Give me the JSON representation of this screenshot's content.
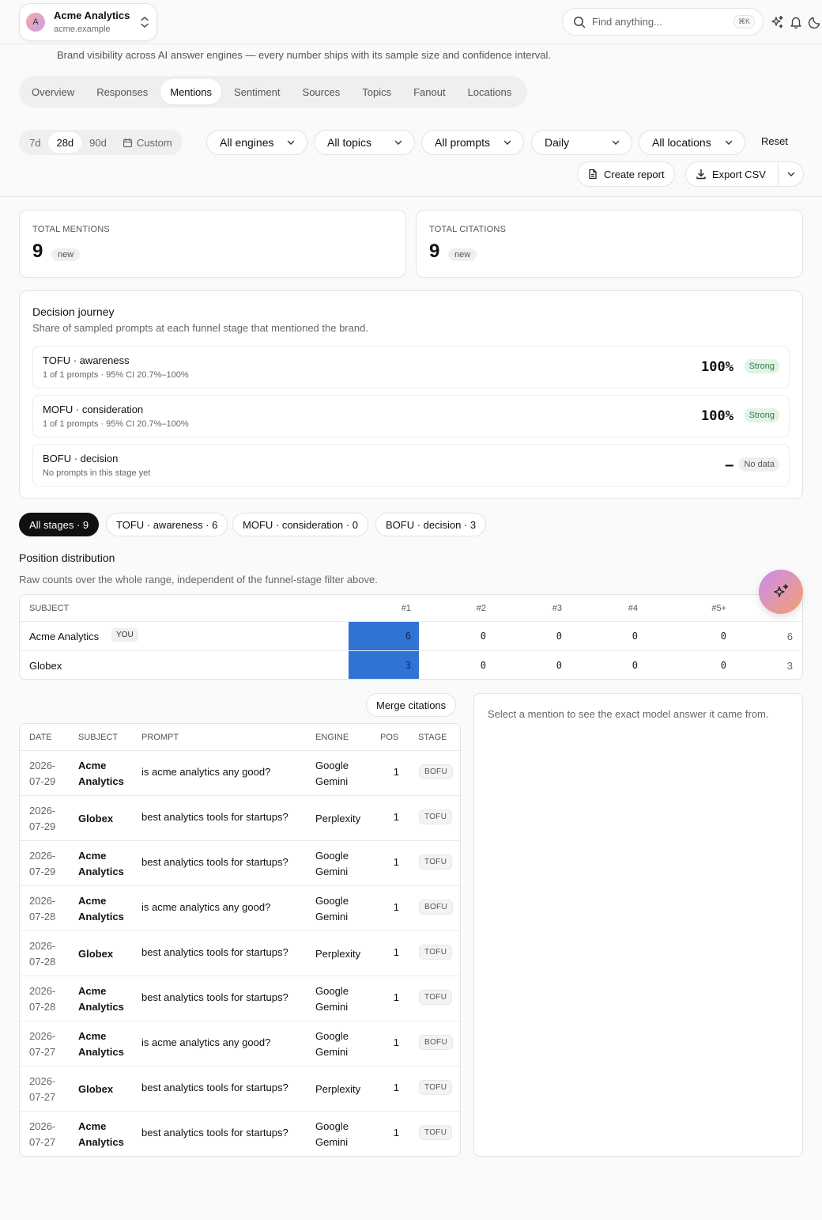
{
  "workspace": {
    "avatar_letter": "A",
    "name": "Acme Analytics",
    "domain": "acme.example"
  },
  "search": {
    "placeholder": "Find anything...",
    "shortcut": "⌘K"
  },
  "subtitle": "Brand visibility across AI answer engines — every number ships with its sample size and confidence interval.",
  "tabs": [
    {
      "label": "Overview"
    },
    {
      "label": "Responses"
    },
    {
      "label": "Mentions",
      "active": true
    },
    {
      "label": "Sentiment"
    },
    {
      "label": "Sources"
    },
    {
      "label": "Topics"
    },
    {
      "label": "Fanout"
    },
    {
      "label": "Locations"
    }
  ],
  "filters": {
    "ranges": [
      "7d",
      "28d",
      "90d",
      "Custom"
    ],
    "active_range": "28d",
    "engine": "All engines",
    "topic": "All topics",
    "prompt": "All prompts",
    "granularity": "Daily",
    "location": "All locations",
    "reset": "Reset",
    "create_report": "Create report",
    "export_csv": "Export CSV"
  },
  "stats": {
    "mentions": {
      "label": "TOTAL MENTIONS",
      "value": "9",
      "badge": "new"
    },
    "citations": {
      "label": "TOTAL CITATIONS",
      "value": "9",
      "badge": "new"
    }
  },
  "journey": {
    "title": "Decision journey",
    "subtitle": "Share of sampled prompts at each funnel stage that mentioned the brand.",
    "stages": [
      {
        "name": "TOFU · awareness",
        "meta": "1 of 1 prompts · 95% CI 20.7%–100%",
        "value": "100%",
        "badge": "Strong"
      },
      {
        "name": "MOFU · consideration",
        "meta": "1 of 1 prompts · 95% CI 20.7%–100%",
        "value": "100%",
        "badge": "Strong"
      },
      {
        "name": "BOFU · decision",
        "meta": "No prompts in this stage yet",
        "value": "–",
        "badge": "No data"
      }
    ]
  },
  "stage_chips": [
    {
      "label": "All stages · 9",
      "active": true
    },
    {
      "label": "TOFU · awareness · 6"
    },
    {
      "label": "MOFU · consideration · 0"
    },
    {
      "label": "BOFU · decision · 3"
    }
  ],
  "position": {
    "title": "Position distribution",
    "subtitle": "Raw counts over the whole range, independent of the funnel-stage filter above.",
    "headers": [
      "SUBJECT",
      "#1",
      "#2",
      "#3",
      "#4",
      "#5+"
    ],
    "you_badge": "YOU",
    "rows": [
      {
        "subject": "Acme Analytics",
        "you": true,
        "counts": [
          "6",
          "0",
          "0",
          "0",
          "0"
        ],
        "total": "6"
      },
      {
        "subject": "Globex",
        "counts": [
          "3",
          "0",
          "0",
          "0",
          "0"
        ],
        "total": "3"
      }
    ],
    "highlight_color": "#2f73d4"
  },
  "mentions": {
    "merge_label": "Merge citations",
    "headers": [
      "DATE",
      "SUBJECT",
      "PROMPT",
      "ENGINE",
      "POS",
      "STAGE"
    ],
    "rows": [
      {
        "date": "2026-07-29",
        "subject": "Acme Analytics",
        "prompt": "is acme analytics any good?",
        "engine": "Google Gemini",
        "pos": "1",
        "stage": "BOFU"
      },
      {
        "date": "2026-07-29",
        "subject": "Globex",
        "prompt": "best analytics tools for startups?",
        "engine": "Perplexity",
        "pos": "1",
        "stage": "TOFU"
      },
      {
        "date": "2026-07-29",
        "subject": "Acme Analytics",
        "prompt": "best analytics tools for startups?",
        "engine": "Google Gemini",
        "pos": "1",
        "stage": "TOFU"
      },
      {
        "date": "2026-07-28",
        "subject": "Acme Analytics",
        "prompt": "is acme analytics any good?",
        "engine": "Google Gemini",
        "pos": "1",
        "stage": "BOFU"
      },
      {
        "date": "2026-07-28",
        "subject": "Globex",
        "prompt": "best analytics tools for startups?",
        "engine": "Perplexity",
        "pos": "1",
        "stage": "TOFU"
      },
      {
        "date": "2026-07-28",
        "subject": "Acme Analytics",
        "prompt": "best analytics tools for startups?",
        "engine": "Google Gemini",
        "pos": "1",
        "stage": "TOFU"
      },
      {
        "date": "2026-07-27",
        "subject": "Acme Analytics",
        "prompt": "is acme analytics any good?",
        "engine": "Google Gemini",
        "pos": "1",
        "stage": "BOFU"
      },
      {
        "date": "2026-07-27",
        "subject": "Globex",
        "prompt": "best analytics tools for startups?",
        "engine": "Perplexity",
        "pos": "1",
        "stage": "TOFU"
      },
      {
        "date": "2026-07-27",
        "subject": "Acme Analytics",
        "prompt": "best analytics tools for startups?",
        "engine": "Google Gemini",
        "pos": "1",
        "stage": "TOFU"
      }
    ]
  },
  "detail": {
    "placeholder": "Select a mention to see the exact model answer it came from."
  }
}
